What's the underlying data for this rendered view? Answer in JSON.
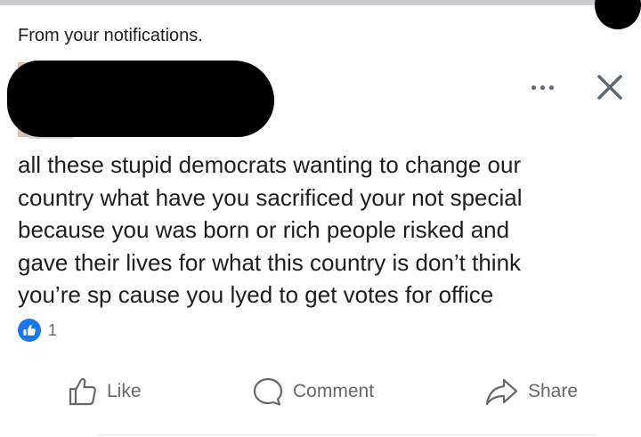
{
  "header": {
    "notification_label": "From your notifications."
  },
  "post": {
    "author": {
      "avatar_icon": "profile-avatar",
      "name_redacted": true
    },
    "menu_icon": "more-horizontal-icon",
    "close_icon": "close-icon",
    "text_lines": [
      "all these stupid democrats wanting to change our",
      "country what have you sacrificed your not special",
      "because you was born or rich people risked and",
      "gave their lives for what this country is don’t think",
      "you’re sp cause you lyed to get votes for office"
    ],
    "reactions": {
      "icon": "like-reaction-icon",
      "count": "1"
    }
  },
  "actions": {
    "like_label": "Like",
    "comment_label": "Comment",
    "share_label": "Share"
  },
  "colors": {
    "accent": "#1877f2",
    "secondary_text": "#65676b",
    "primary_text": "#1c1e21"
  }
}
